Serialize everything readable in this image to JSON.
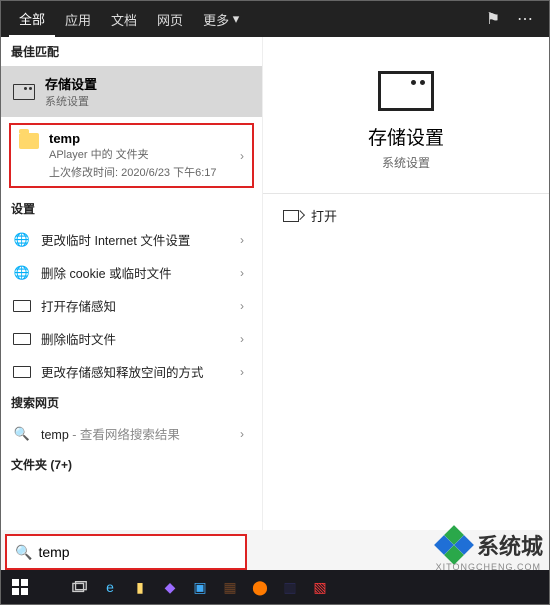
{
  "tabs": {
    "all": "全部",
    "apps": "应用",
    "docs": "文档",
    "web": "网页",
    "more": "更多"
  },
  "left": {
    "best_match": "最佳匹配",
    "storage": {
      "title": "存储设置",
      "subtitle": "系统设置"
    },
    "folder": {
      "title": "temp",
      "subtitle": "APlayer 中的 文件夹",
      "modified": "上次修改时间: 2020/6/23 下午6:17"
    },
    "settings_label": "设置",
    "settings": {
      "s1": "更改临时 Internet 文件设置",
      "s2": "删除 cookie 或临时文件",
      "s3": "打开存储感知",
      "s4": "删除临时文件",
      "s5": "更改存储感知释放空间的方式"
    },
    "search_web_label": "搜索网页",
    "web_item_prefix": "temp",
    "web_item_suffix": " - 查看网络搜索结果",
    "folders_label": "文件夹 (7+)"
  },
  "right": {
    "title": "存储设置",
    "subtitle": "系统设置",
    "open": "打开"
  },
  "search": {
    "value": "temp"
  },
  "watermark": {
    "brand": "系统城",
    "url": "XITONGCHENG.COM"
  }
}
